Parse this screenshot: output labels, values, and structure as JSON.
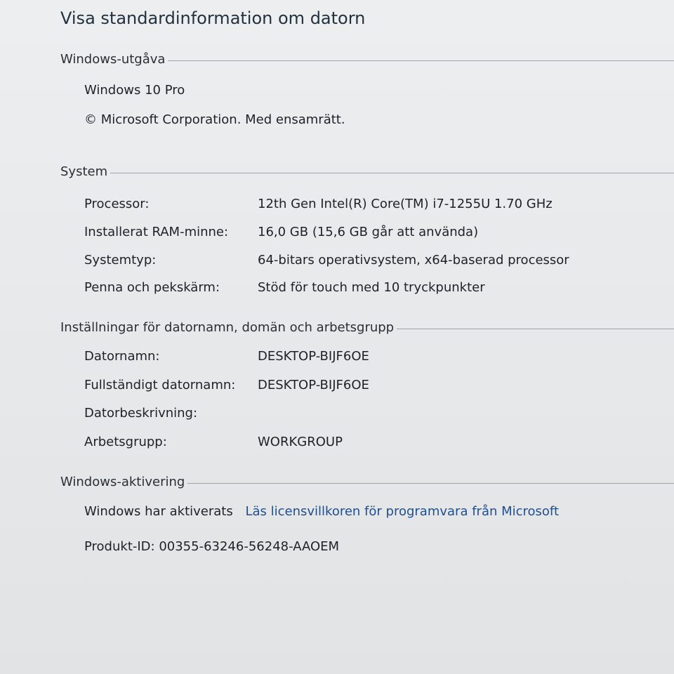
{
  "page_title": "Visa standardinformation om datorn",
  "sections": {
    "edition": {
      "header": "Windows-utgåva",
      "edition_name": "Windows 10 Pro",
      "copyright": "© Microsoft Corporation. Med ensamrätt."
    },
    "system": {
      "header": "System",
      "rows": [
        {
          "key": "Processor:",
          "value": "12th Gen Intel(R) Core(TM) i7-1255U   1.70 GHz"
        },
        {
          "key": "Installerat RAM-minne:",
          "value": "16,0 GB (15,6 GB går att använda)"
        },
        {
          "key": "Systemtyp:",
          "value": "64-bitars operativsystem, x64-baserad processor"
        },
        {
          "key": "Penna och pekskärm:",
          "value": "Stöd för touch med 10 tryckpunkter"
        }
      ]
    },
    "computer_name": {
      "header": "Inställningar för datornamn, domän och arbetsgrupp",
      "rows": [
        {
          "key": "Datornamn:",
          "value": "DESKTOP-BIJF6OE"
        },
        {
          "key": "Fullständigt datornamn:",
          "value": "DESKTOP-BIJF6OE"
        },
        {
          "key": "Datorbeskrivning:",
          "value": ""
        },
        {
          "key": "Arbetsgrupp:",
          "value": "WORKGROUP"
        }
      ]
    },
    "activation": {
      "header": "Windows-aktivering",
      "status": "Windows har aktiverats",
      "license_link": "Läs licensvillkoren för programvara från Microsoft",
      "product_id": "Produkt-ID:  00355-63246-56248-AAOEM"
    }
  }
}
